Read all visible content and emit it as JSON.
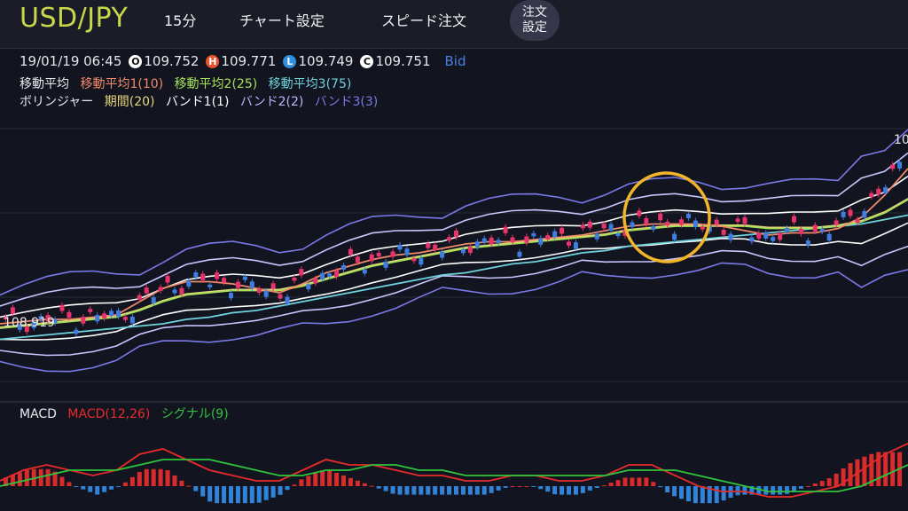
{
  "header": {
    "pair": "USD/JPY",
    "timeframe": "15分",
    "chart_settings": "チャート設定",
    "speed_order": "スピード注文",
    "order_settings_line1": "注文",
    "order_settings_line2": "設定"
  },
  "ohlc": {
    "datetime": "19/01/19 06:45",
    "open_badge": "O",
    "open": "109.752",
    "high_badge": "H",
    "high": "109.771",
    "low_badge": "L",
    "low": "109.749",
    "close_badge": "C",
    "close": "109.751",
    "side": "Bid"
  },
  "legend": {
    "ma_title": "移動平均",
    "ma1": "移動平均1(10)",
    "ma2": "移動平均2(25)",
    "ma3": "移動平均3(75)",
    "bb_title": "ボリンジャー",
    "bb_period": "期間(20)",
    "bb_band1": "バンド1(1)",
    "bb_band2": "バンド2(2)",
    "bb_band3": "バンド3(3)"
  },
  "macd_legend": {
    "title": "MACD",
    "macd": "MACD(12,26)",
    "signal": "シグナル(9)"
  },
  "price_labels": {
    "left": "108.919",
    "right": "10"
  },
  "colors": {
    "background": "#121520",
    "up_candle": "#e8336b",
    "down_candle": "#3f7ee0",
    "ma1": "#f08a6a",
    "ma2": "#a6e05a",
    "ma3": "#6fd3dd",
    "bb_mid": "#e8d77a",
    "band1": "#ffffff",
    "band2": "#c9c6ff",
    "band3": "#7b79e8",
    "macd_line": "#e82a2a",
    "signal_line": "#2fc43c",
    "hist_pos": "#d92b2b",
    "hist_neg": "#2f83d9",
    "annotation_circle": "#f2b52a",
    "pair_text": "#c9d84a"
  },
  "chart_data": {
    "type": "line",
    "series": [
      {
        "name": "移動平均1(10)",
        "values": [
          108.96,
          108.97,
          108.98,
          108.98,
          108.99,
          109.0,
          109.06,
          109.12,
          109.15,
          109.15,
          109.14,
          109.12,
          109.1,
          109.14,
          109.19,
          109.22,
          109.25,
          109.27,
          109.28,
          109.3,
          109.32,
          109.33,
          109.33,
          109.34,
          109.35,
          109.36,
          109.38,
          109.4,
          109.41,
          109.41,
          109.41,
          109.4,
          109.38,
          109.36,
          109.37,
          109.37,
          109.39,
          109.44,
          109.54,
          109.66
        ]
      },
      {
        "name": "移動平均2(25)",
        "values": [
          108.94,
          108.95,
          108.96,
          108.97,
          108.98,
          108.99,
          109.02,
          109.06,
          109.09,
          109.1,
          109.11,
          109.11,
          109.11,
          109.13,
          109.16,
          109.19,
          109.22,
          109.24,
          109.26,
          109.28,
          109.3,
          109.31,
          109.32,
          109.33,
          109.34,
          109.35,
          109.36,
          109.38,
          109.39,
          109.4,
          109.4,
          109.4,
          109.4,
          109.39,
          109.39,
          109.39,
          109.4,
          109.42,
          109.46,
          109.52
        ]
      },
      {
        "name": "移動平均3(75)",
        "values": [
          108.89,
          108.9,
          108.91,
          108.92,
          108.93,
          108.94,
          108.95,
          108.96,
          108.98,
          108.99,
          109.01,
          109.02,
          109.04,
          109.06,
          109.08,
          109.1,
          109.12,
          109.14,
          109.16,
          109.18,
          109.19,
          109.21,
          109.23,
          109.24,
          109.26,
          109.28,
          109.29,
          109.31,
          109.32,
          109.33,
          109.34,
          109.35,
          109.36,
          109.37,
          109.38,
          109.39,
          109.4,
          109.41,
          109.43,
          109.45
        ]
      },
      {
        "name": "MACD(12,26)",
        "values": [
          0.01,
          0.03,
          0.04,
          0.03,
          0.02,
          0.03,
          0.06,
          0.07,
          0.05,
          0.03,
          0.02,
          0.01,
          0.01,
          0.03,
          0.05,
          0.04,
          0.04,
          0.03,
          0.02,
          0.02,
          0.01,
          0.01,
          0.02,
          0.02,
          0.01,
          0.01,
          0.02,
          0.04,
          0.04,
          0.02,
          0.0,
          -0.01,
          -0.01,
          -0.02,
          -0.02,
          -0.01,
          0.0,
          0.03,
          0.06,
          0.08
        ]
      },
      {
        "name": "シグナル(9)",
        "values": [
          0.0,
          0.01,
          0.02,
          0.03,
          0.03,
          0.03,
          0.04,
          0.05,
          0.05,
          0.05,
          0.04,
          0.03,
          0.02,
          0.02,
          0.03,
          0.03,
          0.04,
          0.04,
          0.03,
          0.03,
          0.02,
          0.02,
          0.02,
          0.02,
          0.02,
          0.02,
          0.02,
          0.03,
          0.03,
          0.03,
          0.02,
          0.01,
          0.0,
          -0.01,
          -0.01,
          -0.01,
          -0.01,
          0.0,
          0.02,
          0.04
        ]
      }
    ],
    "ylim": [
      108.7,
      109.9
    ],
    "y_label_visible": "108.919",
    "grid": true
  }
}
